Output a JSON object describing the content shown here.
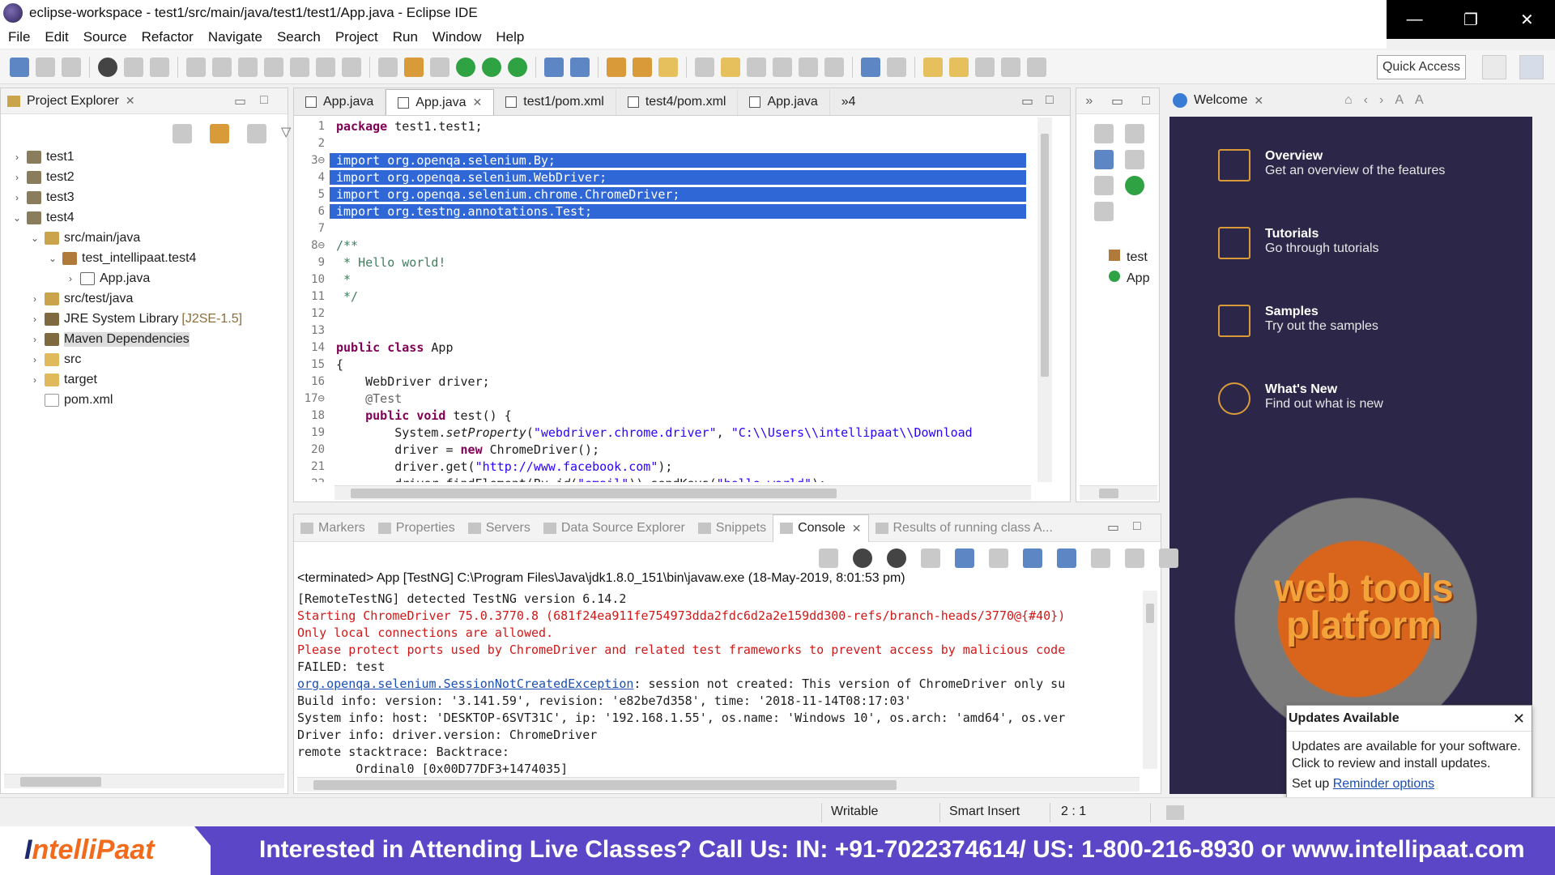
{
  "window": {
    "title": "eclipse-workspace - test1/src/main/java/test1/test1/App.java - Eclipse IDE",
    "controls": [
      "—",
      "❐",
      "✕"
    ]
  },
  "menu": [
    "File",
    "Edit",
    "Source",
    "Refactor",
    "Navigate",
    "Search",
    "Project",
    "Run",
    "Window",
    "Help"
  ],
  "toolbar": {
    "quick_access": "Quick Access"
  },
  "project_explorer": {
    "title": "Project Explorer",
    "tree": [
      {
        "label": "test1",
        "indent": 0,
        "chev": "›",
        "icon": "project"
      },
      {
        "label": "test2",
        "indent": 0,
        "chev": "›",
        "icon": "project"
      },
      {
        "label": "test3",
        "indent": 0,
        "chev": "›",
        "icon": "project"
      },
      {
        "label": "test4",
        "indent": 0,
        "chev": "⌄",
        "icon": "project"
      },
      {
        "label": "src/main/java",
        "indent": 1,
        "chev": "⌄",
        "icon": "srcfolder"
      },
      {
        "label": "test_intellipaat.test4",
        "indent": 2,
        "chev": "⌄",
        "icon": "pkg"
      },
      {
        "label": "App.java",
        "indent": 3,
        "chev": "›",
        "icon": "java"
      },
      {
        "label": "src/test/java",
        "indent": 1,
        "chev": "›",
        "icon": "srcfolder"
      },
      {
        "label": "JRE System Library",
        "extra": "[J2SE-1.5]",
        "indent": 1,
        "chev": "›",
        "icon": "lib"
      },
      {
        "label": "Maven Dependencies",
        "indent": 1,
        "chev": "›",
        "icon": "lib",
        "highlight": true
      },
      {
        "label": "src",
        "indent": 1,
        "chev": "›",
        "icon": "folder"
      },
      {
        "label": "target",
        "indent": 1,
        "chev": "›",
        "icon": "folder"
      },
      {
        "label": "pom.xml",
        "indent": 1,
        "chev": "",
        "icon": "xml"
      }
    ]
  },
  "editor": {
    "tabs": [
      "App.java",
      "App.java",
      "test1/pom.xml",
      "test4/pom.xml",
      "App.java"
    ],
    "active_tab": 1,
    "overflow": "»4",
    "lines": [
      {
        "n": "1",
        "html": "<span class='kw'>package</span> test1.test1;"
      },
      {
        "n": "2",
        "html": ""
      },
      {
        "n": "3⊖",
        "html": "<span>import org.openqa.selenium.By;</span>",
        "sel": true
      },
      {
        "n": "4",
        "html": "<span>import org.openqa.selenium.WebDriver;</span>",
        "sel": true
      },
      {
        "n": "5",
        "html": "<span>import org.openqa.selenium.chrome.ChromeDriver;</span>",
        "sel": true
      },
      {
        "n": "6",
        "html": "<span>import org.testng.annotations.Test;</span>",
        "sel": true
      },
      {
        "n": "7",
        "html": ""
      },
      {
        "n": "8⊖",
        "html": "<span class='cmt'>/**</span>"
      },
      {
        "n": "9",
        "html": "<span class='cmt'> * Hello world!</span>"
      },
      {
        "n": "10",
        "html": "<span class='cmt'> *</span>"
      },
      {
        "n": "11",
        "html": "<span class='cmt'> */</span>"
      },
      {
        "n": "12",
        "html": ""
      },
      {
        "n": "13",
        "html": ""
      },
      {
        "n": "14",
        "html": "<span class='kw'>public class</span> App"
      },
      {
        "n": "15",
        "html": "{"
      },
      {
        "n": "16",
        "html": "    WebDriver driver;"
      },
      {
        "n": "17⊖",
        "html": "    <span class='ann'>@Test</span>"
      },
      {
        "n": "18",
        "html": "    <span class='kw'>public void</span> test() {"
      },
      {
        "n": "19",
        "html": "        System.<i>setProperty</i>(<span class='str'>\"webdriver.chrome.driver\"</span>, <span class='str'>\"C:\\\\Users\\\\intellipaat\\\\Download</span>"
      },
      {
        "n": "20",
        "html": "        driver = <span class='kw'>new</span> ChromeDriver();"
      },
      {
        "n": "21",
        "html": "        driver.get(<span class='str'>\"http://www.facebook.com\"</span>);"
      },
      {
        "n": "22",
        "html": "        driver.findElement(By.<i>id</i>(<span class='str'>\"email\"</span>)).sendKeys(<span class='str'>\"hello world\"</span>);"
      }
    ]
  },
  "outline": {
    "items": [
      "test",
      "App"
    ]
  },
  "welcome": {
    "title": "Welcome",
    "items": [
      {
        "title": "Overview",
        "sub": "Get an overview of the features"
      },
      {
        "title": "Tutorials",
        "sub": "Go through tutorials"
      },
      {
        "title": "Samples",
        "sub": "Try out the samples"
      },
      {
        "title": "What's New",
        "sub": "Find out what is new"
      }
    ],
    "logo_text": "web tools platform"
  },
  "updates": {
    "title": "Updates Available",
    "body": "Updates are available for your software. Click to review and install updates.",
    "setup": "Set up",
    "link": "Reminder options"
  },
  "console": {
    "tabs": [
      "Markers",
      "Properties",
      "Servers",
      "Data Source Explorer",
      "Snippets",
      "Console",
      "Results of running class A..."
    ],
    "active_tab": 5,
    "status": "<terminated> App [TestNG] C:\\Program Files\\Java\\jdk1.8.0_151\\bin\\javaw.exe (18-May-2019, 8:01:53 pm)",
    "lines": [
      {
        "t": "[RemoteTestNG] detected TestNG version 6.14.2",
        "c": ""
      },
      {
        "t": "Starting ChromeDriver 75.0.3770.8 (681f24ea911fe754973dda2fdc6d2a2e159dd300-refs/branch-heads/3770@{#40})",
        "c": "err"
      },
      {
        "t": "Only local connections are allowed.",
        "c": "err"
      },
      {
        "t": "Please protect ports used by ChromeDriver and related test frameworks to prevent access by malicious code",
        "c": "err"
      },
      {
        "t": "FAILED: test",
        "c": ""
      },
      {
        "t": "org.openqa.selenium.SessionNotCreatedException",
        "rest": ": session not created: This version of ChromeDriver only su",
        "c": "link"
      },
      {
        "t": "Build info: version: '3.141.59', revision: 'e82be7d358', time: '2018-11-14T08:17:03'",
        "c": ""
      },
      {
        "t": "System info: host: 'DESKTOP-6SVT31C', ip: '192.168.1.55', os.name: 'Windows 10', os.arch: 'amd64', os.ver",
        "c": ""
      },
      {
        "t": "Driver info: driver.version: ChromeDriver",
        "c": ""
      },
      {
        "t": "remote stacktrace: Backtrace:",
        "c": ""
      },
      {
        "t": "        Ordinal0 [0x00D77DF3+1474035]",
        "c": ""
      }
    ]
  },
  "statusbar": {
    "writable": "Writable",
    "insert": "Smart Insert",
    "position": "2 : 1"
  },
  "banner": {
    "logo": "ntelliPaat",
    "logo_i": "I",
    "text": "Interested in Attending Live Classes? Call Us: IN: +91-7022374614/ US: 1-800-216-8930 or www.intellipaat.com"
  },
  "colors": {
    "selection": "#2f67d6",
    "welcome_bg": "#2c2748",
    "banner": "#5a46c6",
    "error_text": "#d01818"
  }
}
